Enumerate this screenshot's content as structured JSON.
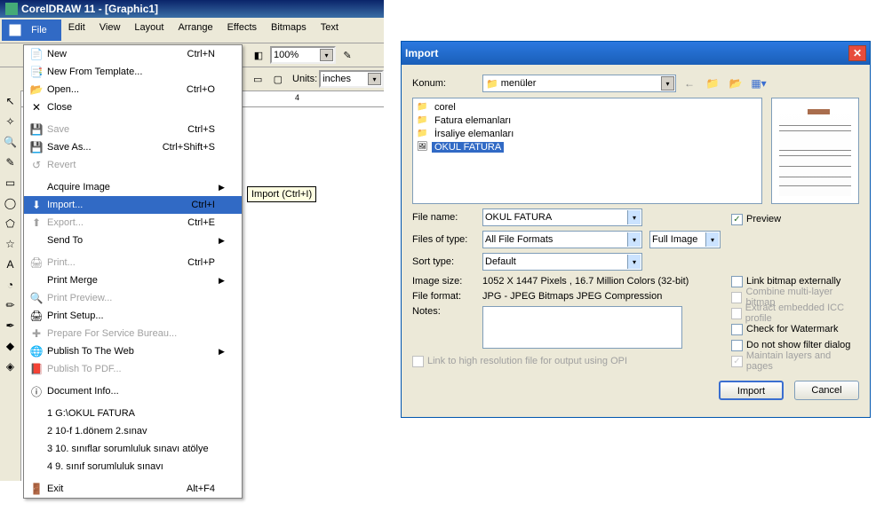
{
  "title": "CorelDRAW 11 - [Graphic1]",
  "menubar": [
    "File",
    "Edit",
    "View",
    "Layout",
    "Arrange",
    "Effects",
    "Bitmaps",
    "Text"
  ],
  "toolbar": {
    "zoom": "100%",
    "units_label": "Units:",
    "units_value": "inches"
  },
  "tooltip": "Import (Ctrl+I)",
  "filemenu": [
    {
      "t": "item",
      "icon": "📄",
      "label": "New",
      "short": "Ctrl+N"
    },
    {
      "t": "item",
      "icon": "📑",
      "label": "New From Template..."
    },
    {
      "t": "item",
      "icon": "📂",
      "label": "Open...",
      "short": "Ctrl+O"
    },
    {
      "t": "item",
      "icon": "✕",
      "label": "Close"
    },
    {
      "t": "sep"
    },
    {
      "t": "item",
      "icon": "💾",
      "label": "Save",
      "short": "Ctrl+S",
      "dis": true
    },
    {
      "t": "item",
      "icon": "💾",
      "label": "Save As...",
      "short": "Ctrl+Shift+S"
    },
    {
      "t": "item",
      "icon": "↺",
      "label": "Revert",
      "dis": true
    },
    {
      "t": "sep"
    },
    {
      "t": "item",
      "label": "Acquire Image",
      "sub": true
    },
    {
      "t": "item",
      "icon": "⬇",
      "label": "Import...",
      "short": "Ctrl+I",
      "sel": true
    },
    {
      "t": "item",
      "icon": "⬆",
      "label": "Export...",
      "short": "Ctrl+E",
      "dis": true
    },
    {
      "t": "item",
      "label": "Send To",
      "sub": true
    },
    {
      "t": "sep"
    },
    {
      "t": "item",
      "icon": "🖨",
      "label": "Print...",
      "short": "Ctrl+P",
      "dis": true
    },
    {
      "t": "item",
      "label": "Print Merge",
      "sub": true
    },
    {
      "t": "item",
      "icon": "🔍",
      "label": "Print Preview...",
      "dis": true
    },
    {
      "t": "item",
      "icon": "🖨",
      "label": "Print Setup..."
    },
    {
      "t": "item",
      "icon": "✚",
      "label": "Prepare For Service Bureau...",
      "dis": true
    },
    {
      "t": "item",
      "icon": "🌐",
      "label": "Publish To The Web",
      "sub": true
    },
    {
      "t": "item",
      "icon": "📕",
      "label": "Publish To PDF...",
      "dis": true
    },
    {
      "t": "sep"
    },
    {
      "t": "item",
      "icon": "ⓘ",
      "label": "Document Info..."
    },
    {
      "t": "sep"
    },
    {
      "t": "item",
      "label": "1 G:\\OKUL FATURA"
    },
    {
      "t": "item",
      "label": "2 10-f 1.dönem 2.sınav"
    },
    {
      "t": "item",
      "label": "3 10. sınıflar sorumluluk sınavı atölye"
    },
    {
      "t": "item",
      "label": "4 9. sınıf sorumluluk sınavı"
    },
    {
      "t": "sep"
    },
    {
      "t": "item",
      "icon": "🚪",
      "label": "Exit",
      "short": "Alt+F4"
    }
  ],
  "dialog": {
    "title": "Import",
    "loc_label": "Konum:",
    "loc_value": "menüler",
    "files": [
      {
        "icon": "📁",
        "name": "corel"
      },
      {
        "icon": "📁",
        "name": "Fatura elemanları"
      },
      {
        "icon": "📁",
        "name": "İrsaliye elemanları"
      },
      {
        "icon": "🖼",
        "name": "OKUL FATURA",
        "sel": true
      }
    ],
    "filename_label": "File name:",
    "filename_val": "OKUL FATURA",
    "filetype_label": "Files of type:",
    "filetype_val": "All File Formats",
    "fullimage": "Full Image",
    "sort_label": "Sort type:",
    "sort_val": "Default",
    "imgsize_label": "Image size:",
    "imgsize_val": "1052 X 1447 Pixels , 16.7 Million Colors (32-bit)",
    "fmt_label": "File format:",
    "fmt_val": "JPG - JPEG Bitmaps JPEG Compression",
    "notes_label": "Notes:",
    "opi": "Link to high resolution file for output using OPI",
    "preview_label": "Preview",
    "opts": {
      "link_ext": "Link bitmap externally",
      "combine": "Combine multi-layer bitmap",
      "icc": "Extract embedded ICC profile",
      "watermark": "Check for Watermark",
      "nofilter": "Do not show filter dialog",
      "layers": "Maintain layers and pages"
    },
    "import_btn": "Import",
    "cancel_btn": "Cancel"
  }
}
